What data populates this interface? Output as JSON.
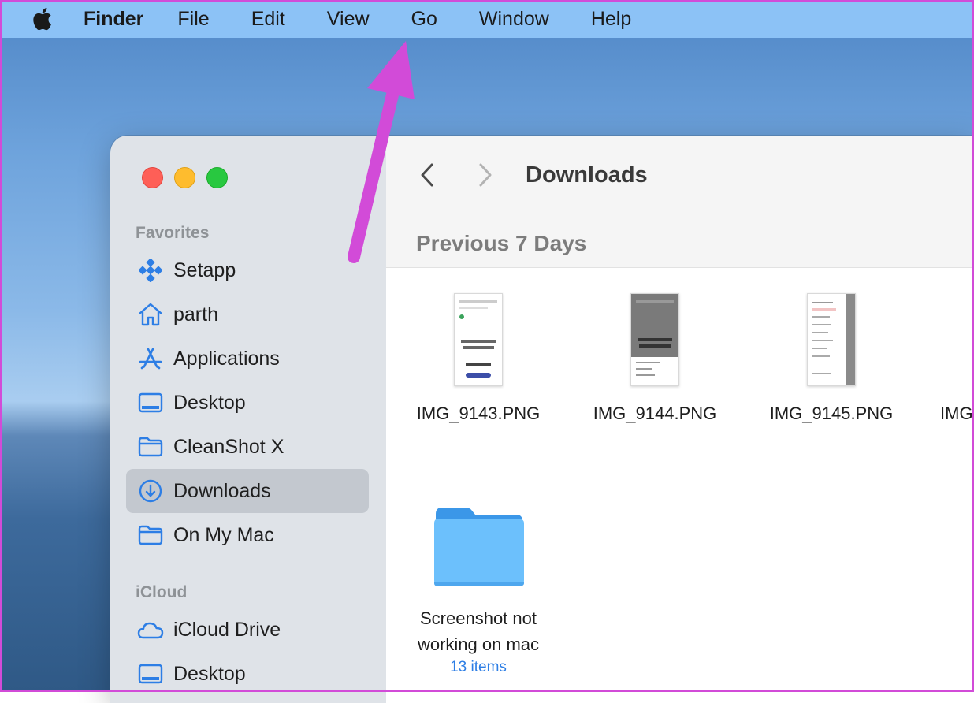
{
  "menubar": {
    "app": "Finder",
    "items": [
      "File",
      "Edit",
      "View",
      "Go",
      "Window",
      "Help"
    ]
  },
  "window": {
    "title": "Downloads"
  },
  "sidebar": {
    "favorites_header": "Favorites",
    "favorites": [
      {
        "label": "Setapp",
        "icon": "setapp-icon"
      },
      {
        "label": "parth",
        "icon": "home-icon"
      },
      {
        "label": "Applications",
        "icon": "applications-icon"
      },
      {
        "label": "Desktop",
        "icon": "desktop-icon"
      },
      {
        "label": "CleanShot X",
        "icon": "folder-icon"
      },
      {
        "label": "Downloads",
        "icon": "downloads-icon",
        "selected": true
      },
      {
        "label": "On My Mac",
        "icon": "folder-icon"
      }
    ],
    "icloud_header": "iCloud",
    "icloud": [
      {
        "label": "iCloud Drive",
        "icon": "cloud-icon"
      },
      {
        "label": "Desktop",
        "icon": "desktop-icon"
      }
    ]
  },
  "content": {
    "group_title": "Previous 7 Days",
    "files": [
      {
        "name": "IMG_9143.PNG"
      },
      {
        "name": "IMG_9144.PNG"
      },
      {
        "name": "IMG_9145.PNG"
      },
      {
        "name": "IMG"
      }
    ],
    "folder": {
      "name_line1": "Screenshot not",
      "name_line2": "working on mac",
      "count": "13 items"
    }
  },
  "colors": {
    "accent": "#2d7ee5",
    "arrow": "#d24bd8",
    "menubar": "#8cc2f6"
  }
}
